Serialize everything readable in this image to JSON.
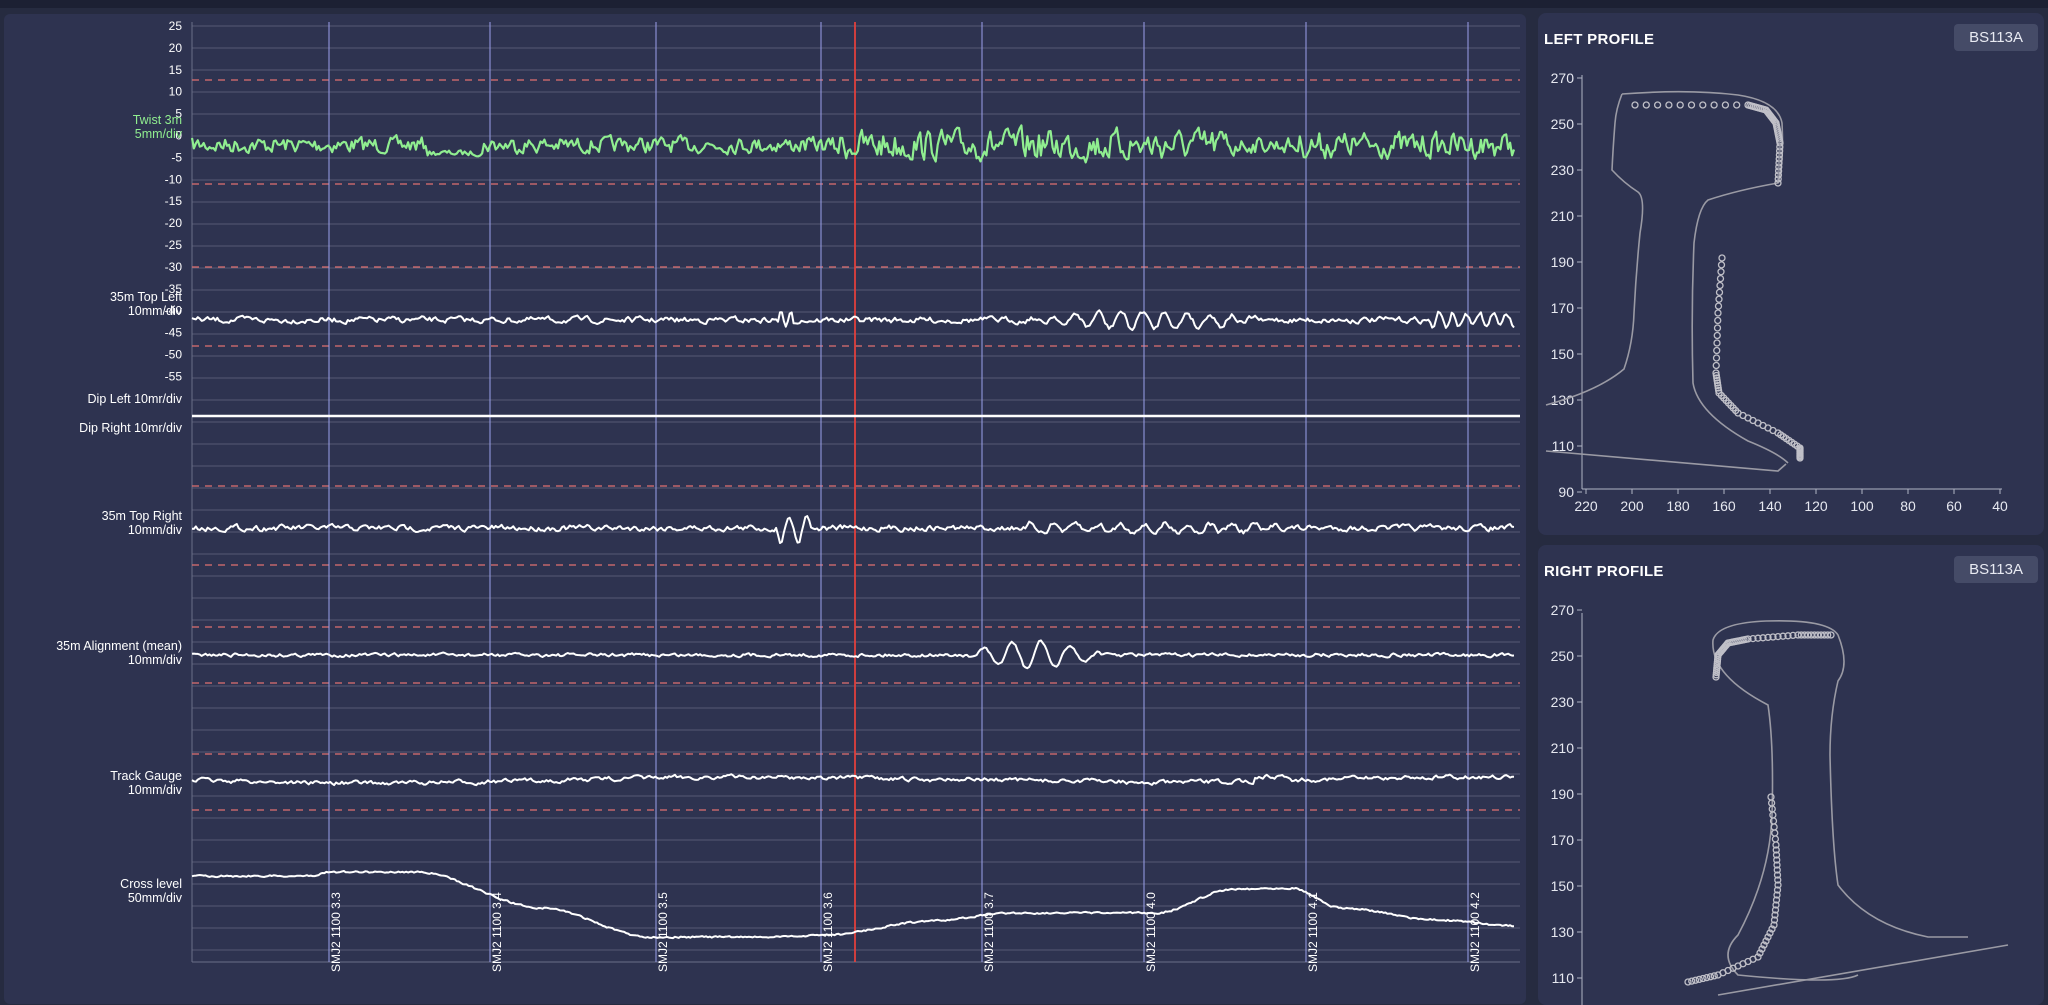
{
  "colors": {
    "background": "#262b40",
    "panel": "#2e3350",
    "twist": "#90ee90",
    "trace": "#ffffff",
    "limit_dash": "#e07070",
    "cursor": "#e0403c",
    "marker": "#9a9ee8",
    "grid": "#555a74",
    "profile_outline": "#9a9aa4"
  },
  "main_chart": {
    "twist_ticks": [
      "25",
      "20",
      "15",
      "10",
      "5",
      "0",
      "-5",
      "-10",
      "-15",
      "-20",
      "-25",
      "-30",
      "-35",
      "-40",
      "-45",
      "-50",
      "-55"
    ],
    "channels": [
      {
        "name": "Twist 3m",
        "scale": "5mm/div"
      },
      {
        "name": "35m Top Left",
        "scale": "10mm/div"
      },
      {
        "name": "Dip Left 10mr/div",
        "scale": ""
      },
      {
        "name": "Dip Right 10mr/div",
        "scale": ""
      },
      {
        "name": "35m Top Right",
        "scale": "10mm/div"
      },
      {
        "name": "35m Alignment (mean)",
        "scale": "10mm/div"
      },
      {
        "name": "Track Gauge",
        "scale": "10mm/div"
      },
      {
        "name": "Cross level",
        "scale": "50mm/div"
      }
    ],
    "markers": [
      "SMJ2 1100 3.3",
      "SMJ2 1100 3.4",
      "SMJ2 1100 3.5",
      "SMJ2 1100 3.6",
      "SMJ2 1100 3.7",
      "SMJ2 1100 4.0",
      "SMJ2 1100 4.1",
      "SMJ2 1100 4.2"
    ]
  },
  "left_profile": {
    "title": "LEFT PROFILE",
    "badge": "BS113A",
    "y_ticks": [
      "270",
      "250",
      "230",
      "210",
      "190",
      "170",
      "150",
      "130",
      "110",
      "90"
    ],
    "x_ticks": [
      "220",
      "200",
      "180",
      "160",
      "140",
      "120",
      "100",
      "80",
      "60",
      "40"
    ]
  },
  "right_profile": {
    "title": "RIGHT PROFILE",
    "badge": "BS113A",
    "y_ticks": [
      "270",
      "250",
      "230",
      "210",
      "190",
      "170",
      "150",
      "130",
      "110"
    ]
  }
}
